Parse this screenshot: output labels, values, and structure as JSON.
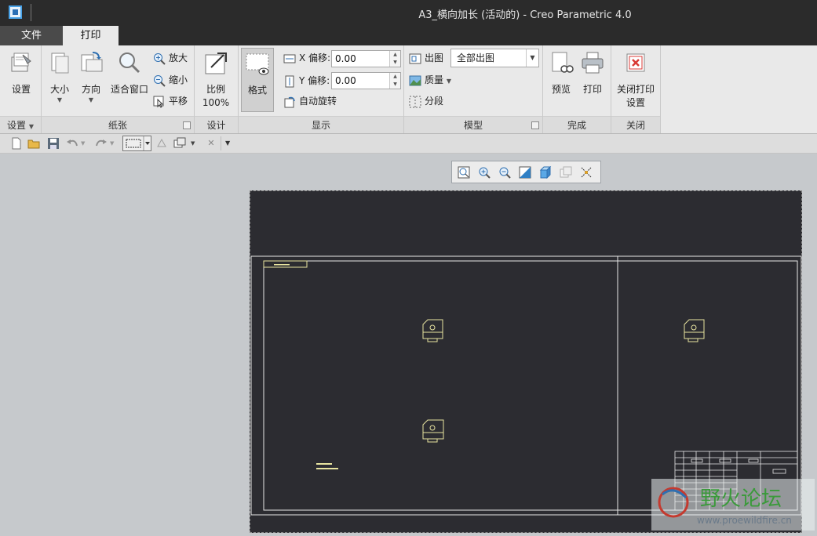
{
  "window": {
    "title": "A3_横向加长 (活动的) - Creo Parametric 4.0"
  },
  "tabs": {
    "file": "文件",
    "print": "打印"
  },
  "groups": {
    "setup": {
      "label": "设置",
      "setup_btn": "设置"
    },
    "paper": {
      "label": "纸张",
      "size_btn": "大小",
      "orientation_btn": "方向",
      "fit_btn": "适合窗口",
      "zoom_in": "放大",
      "zoom_out": "缩小",
      "pan": "平移"
    },
    "design": {
      "label": "设计",
      "scale_btn": "比例",
      "scale_value": "100%"
    },
    "display": {
      "label": "显示",
      "format_btn": "格式",
      "x_offset_label": "X 偏移:",
      "x_offset_value": "0.00",
      "y_offset_label": "Y 偏移:",
      "y_offset_value": "0.00",
      "auto_rotate": "自动旋转"
    },
    "model": {
      "label": "模型",
      "output_label": "出图",
      "output_value": "全部出图",
      "quality_label": "质量",
      "segment_label": "分段"
    },
    "finish": {
      "label": "完成",
      "preview_btn": "预览",
      "print_btn": "打印"
    },
    "close": {
      "label": "关闭",
      "close_btn_line1": "关闭打印",
      "close_btn_line2": "设置"
    }
  },
  "colors": {
    "accent": "#4aa3e8",
    "sheet_bg": "#2c2c31",
    "drawing_lines": "#e8e8e8",
    "view_lines": "#e8e4a0",
    "close_red": "#d83a34"
  },
  "watermark": {
    "brand": "野火论坛",
    "url": "www.proewildfire.cn"
  }
}
